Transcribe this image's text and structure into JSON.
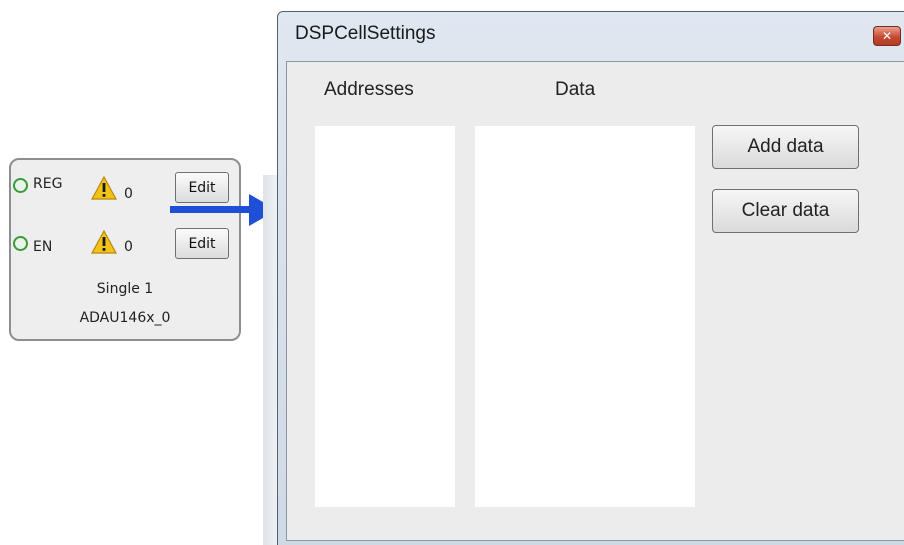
{
  "cell": {
    "rows": [
      {
        "pin": "REG",
        "warnings": "0",
        "edit_label": "Edit"
      },
      {
        "pin": "EN",
        "warnings": "0",
        "edit_label": "Edit"
      }
    ],
    "name": "Single 1",
    "chip": "ADAU146x_0"
  },
  "dialog": {
    "title": "DSPCellSettings",
    "close_glyph": "✕",
    "addresses_header": "Addresses",
    "data_header": "Data",
    "add_data_label": "Add data",
    "clear_data_label": "Clear data"
  },
  "icons": {
    "status": "green-led-icon",
    "warning": "warning-triangle-icon",
    "arrow": "right-arrow-icon"
  },
  "colors": {
    "arrow": "#1f4fd6",
    "led": "#3a9a3a",
    "close": "#c64a33"
  }
}
